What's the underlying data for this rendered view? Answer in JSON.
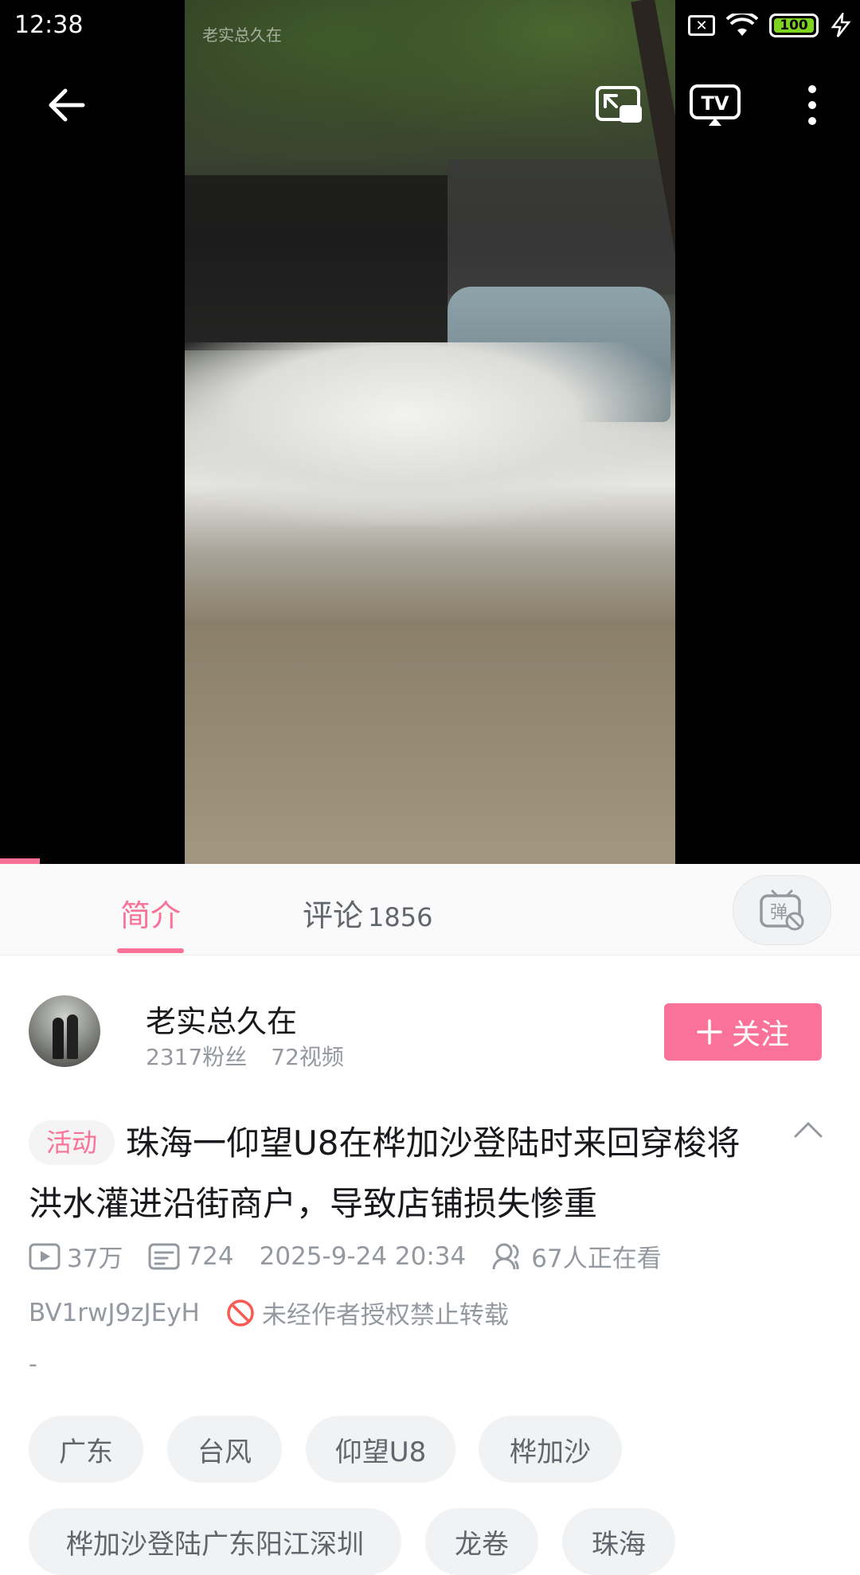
{
  "status_bar": {
    "time": "12:38",
    "battery": "100",
    "sim_icon": "sim-blocked-icon",
    "wifi_icon": "wifi-icon",
    "charging_icon": "bolt-icon"
  },
  "video": {
    "watermark": "老实总久在",
    "progress_fraction": 0.046
  },
  "toolbar": {
    "back_icon": "back-arrow-icon",
    "pip_icon": "picture-in-picture-icon",
    "tv_icon": "tv-cast-icon",
    "more_icon": "more-vert-icon"
  },
  "tabs": {
    "intro": "简介",
    "comments": "评论",
    "comments_count": "1856",
    "danmaku_icon": "danmaku-off-icon"
  },
  "author": {
    "name": "老实总久在",
    "fans": "2317粉丝",
    "videos": "72视频",
    "follow_label": "关注"
  },
  "video_info": {
    "badge": "活动",
    "title": "珠海一仰望U8在桦加沙登陆时来回穿梭将洪水灌进沿街商户，导致店铺损失惨重",
    "views": "37万",
    "danmaku_count": "724",
    "date": "2025-9-24 20:34",
    "watching": "67人正在看",
    "bvid": "BV1rwJ9zJEyH",
    "copyright": "未经作者授权禁止转载",
    "description": "-"
  },
  "tags": [
    "广东",
    "台风",
    "仰望U8",
    "桦加沙",
    "桦加沙登陆广东阳江深圳",
    "龙卷",
    "珠海"
  ],
  "colors": {
    "accent": "#fb7299",
    "muted": "#9499a0",
    "copyright_icon": "#f85a54"
  }
}
